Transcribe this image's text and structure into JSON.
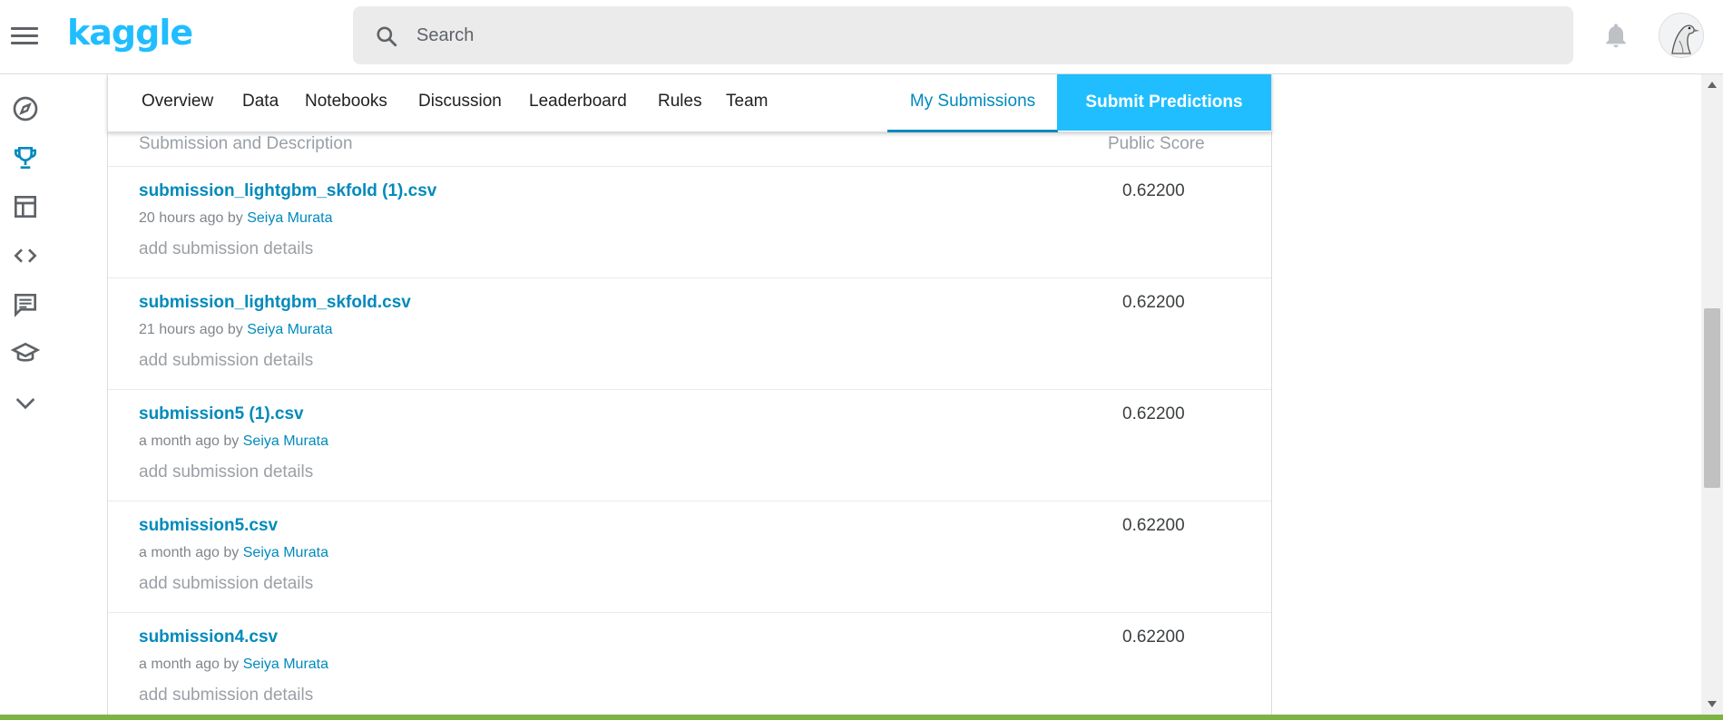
{
  "header": {
    "logo_text": "kaggle",
    "search_placeholder": "Search"
  },
  "tabs": {
    "items": [
      "Overview",
      "Data",
      "Notebooks",
      "Discussion",
      "Leaderboard",
      "Rules",
      "Team"
    ],
    "my_submissions": "My Submissions",
    "submit": "Submit Predictions"
  },
  "table": {
    "col_desc": "Submission and Description",
    "col_score": "Public Score",
    "rows": [
      {
        "file": "submission_lightgbm_skfold (1).csv",
        "time": "20 hours ago by ",
        "author": "Seiya Murata",
        "details": "add submission details",
        "score": "0.62200"
      },
      {
        "file": "submission_lightgbm_skfold.csv",
        "time": "21 hours ago by ",
        "author": "Seiya Murata",
        "details": "add submission details",
        "score": "0.62200"
      },
      {
        "file": "submission5 (1).csv",
        "time": "a month ago by ",
        "author": "Seiya Murata",
        "details": "add submission details",
        "score": "0.62200"
      },
      {
        "file": "submission5.csv",
        "time": "a month ago by ",
        "author": "Seiya Murata",
        "details": "add submission details",
        "score": "0.62200"
      },
      {
        "file": "submission4.csv",
        "time": "a month ago by ",
        "author": "Seiya Murata",
        "details": "add submission details",
        "score": "0.62200"
      }
    ]
  },
  "rail_icons": [
    "compass-icon",
    "trophy-icon",
    "table-icon",
    "code-icon",
    "comment-icon",
    "school-icon",
    "chevron-down-icon"
  ],
  "colors": {
    "accent": "#20beff",
    "link": "#008abc"
  }
}
